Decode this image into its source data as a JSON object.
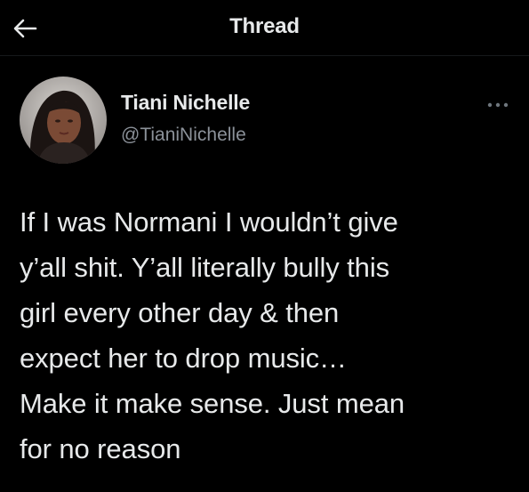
{
  "header": {
    "title": "Thread",
    "back_icon": "arrow-left-icon"
  },
  "tweet": {
    "author": {
      "name": "Tiani Nichelle",
      "handle": "@TianiNichelle",
      "avatar": "profile-photo"
    },
    "more_icon": "more-horizontal-icon",
    "text": "If I was Normani I wouldn’t give\ny’all shit. Y’all literally bully this\ngirl every other day & then\nexpect her to drop music…\nMake it make sense. Just mean\nfor no reason"
  },
  "colors": {
    "background": "#000000",
    "primary_text": "#e7e9ea",
    "secondary_text": "#8b9199"
  }
}
